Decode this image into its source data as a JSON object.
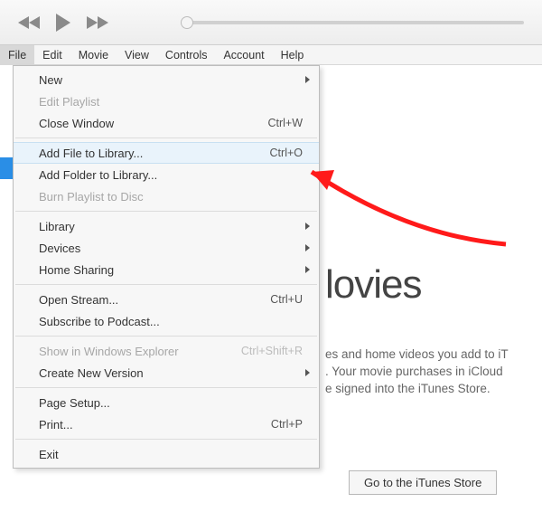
{
  "menubar": {
    "items": [
      "File",
      "Edit",
      "Movie",
      "View",
      "Controls",
      "Account",
      "Help"
    ],
    "active_index": 0
  },
  "file_menu": [
    {
      "label": "New",
      "submenu": true
    },
    {
      "label": "Edit Playlist",
      "disabled": true
    },
    {
      "label": "Close Window",
      "shortcut": "Ctrl+W"
    },
    {
      "separator": true
    },
    {
      "label": "Add File to Library...",
      "shortcut": "Ctrl+O",
      "hover": true
    },
    {
      "label": "Add Folder to Library..."
    },
    {
      "label": "Burn Playlist to Disc",
      "disabled": true
    },
    {
      "separator": true
    },
    {
      "label": "Library",
      "submenu": true
    },
    {
      "label": "Devices",
      "submenu": true
    },
    {
      "label": "Home Sharing",
      "submenu": true
    },
    {
      "separator": true
    },
    {
      "label": "Open Stream...",
      "shortcut": "Ctrl+U"
    },
    {
      "label": "Subscribe to Podcast..."
    },
    {
      "separator": true
    },
    {
      "label": "Show in Windows Explorer",
      "shortcut": "Ctrl+Shift+R",
      "disabled": true
    },
    {
      "label": "Create New Version",
      "submenu": true
    },
    {
      "separator": true
    },
    {
      "label": "Page Setup..."
    },
    {
      "label": "Print...",
      "shortcut": "Ctrl+P"
    },
    {
      "separator": true
    },
    {
      "label": "Exit"
    }
  ],
  "content": {
    "title_fragment": "lovies",
    "body_line1": "es and home videos you add to iT",
    "body_line2": ". Your movie purchases in iCloud",
    "body_line3": "e signed into the iTunes Store.",
    "store_button": "Go to the iTunes Store"
  }
}
